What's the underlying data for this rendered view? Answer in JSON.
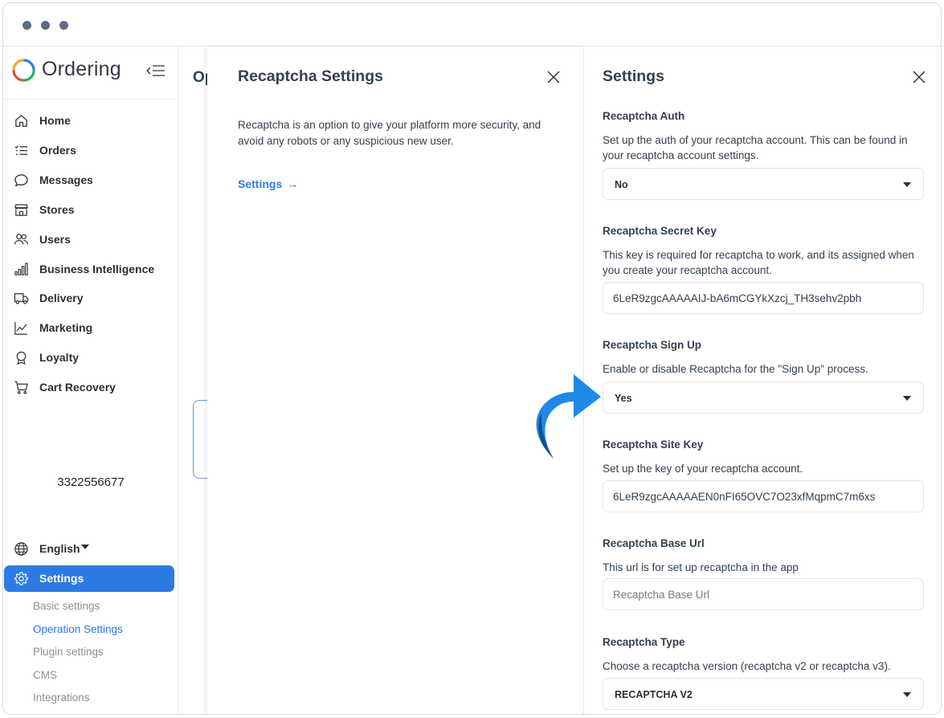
{
  "app": {
    "logo_text": "Ordering"
  },
  "sidebar": {
    "items": [
      {
        "label": "Home",
        "icon": "home-icon"
      },
      {
        "label": "Orders",
        "icon": "list-icon"
      },
      {
        "label": "Messages",
        "icon": "chat-bubble-icon"
      },
      {
        "label": "Stores",
        "icon": "store-icon"
      },
      {
        "label": "Users",
        "icon": "users-icon"
      },
      {
        "label": "Business Intelligence",
        "icon": "bar-chart-icon"
      },
      {
        "label": "Delivery",
        "icon": "truck-icon"
      },
      {
        "label": "Marketing",
        "icon": "line-chart-icon"
      },
      {
        "label": "Loyalty",
        "icon": "award-icon"
      },
      {
        "label": "Cart Recovery",
        "icon": "cart-icon"
      }
    ],
    "phone": "3322556677",
    "language": "English",
    "settings_label": "Settings",
    "sub_items": [
      {
        "label": "Basic settings",
        "active": false
      },
      {
        "label": "Operation Settings",
        "active": true
      },
      {
        "label": "Plugin settings",
        "active": false
      },
      {
        "label": "CMS",
        "active": false
      },
      {
        "label": "Integrations",
        "active": false
      }
    ]
  },
  "background_page": {
    "title_fragment": "Op"
  },
  "mid_panel": {
    "title": "Recaptcha Settings",
    "description": "Recaptcha is an option to give your platform more security, and avoid any robots or any suspicious new user.",
    "link_label": "Settings",
    "link_arrow": "→"
  },
  "right_panel": {
    "title": "Settings",
    "fields": {
      "auth": {
        "title": "Recaptcha Auth",
        "description": "Set up the auth of your recaptcha account. This can be found in your recaptcha account settings.",
        "value": "No"
      },
      "secret_key": {
        "title": "Recaptcha Secret Key",
        "description": "This key is required for recaptcha to work, and its assigned when you create your recaptcha account.",
        "value": "6LeR9zgcAAAAAIJ-bA6mCGYkXzcj_TH3sehv2pbh"
      },
      "sign_up": {
        "title": "Recaptcha Sign Up",
        "description": "Enable or disable Recaptcha for the \"Sign Up\" process.",
        "value": "Yes"
      },
      "site_key": {
        "title": "Recaptcha Site Key",
        "description": "Set up the key of your recaptcha account.",
        "value": "6LeR9zgcAAAAAEN0nFI65OVC7O23xfMqpmC7m6xs"
      },
      "base_url": {
        "title": "Recaptcha Base Url",
        "description": "This url is for set up recaptcha in the app",
        "placeholder": "Recaptcha Base Url"
      },
      "type": {
        "title": "Recaptcha Type",
        "description": "Choose a recaptcha version (recaptcha v2 or recaptcha v3).",
        "value": "RECAPTCHA V2"
      }
    }
  },
  "colors": {
    "accent": "#2c7be5",
    "text": "#344050",
    "annotation_arrow": "#1f8ae6"
  }
}
